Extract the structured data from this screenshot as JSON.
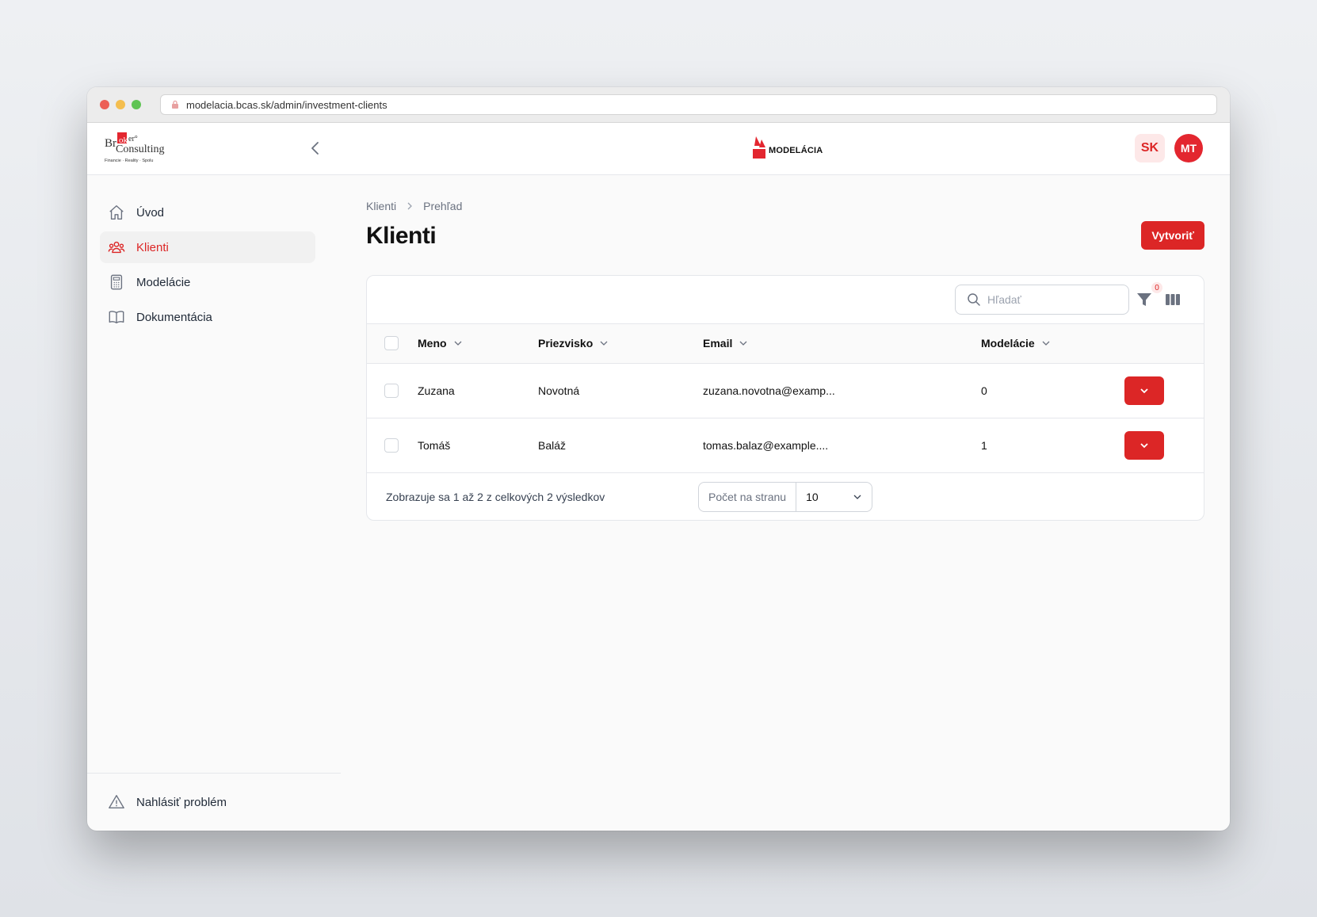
{
  "browser": {
    "url": "modelacia.bcas.sk/admin/investment-clients"
  },
  "topbar": {
    "brand_logo": "Broker Consulting",
    "brand_tagline": "Financie · Reality · Spolu",
    "app_logo_text": "MODELÁCIA",
    "language": "SK",
    "user_initials": "MT"
  },
  "sidebar": {
    "items": [
      {
        "label": "Úvod",
        "icon": "home-icon"
      },
      {
        "label": "Klienti",
        "icon": "users-icon",
        "active": true
      },
      {
        "label": "Modelácie",
        "icon": "calculator-icon"
      },
      {
        "label": "Dokumentácia",
        "icon": "book-icon"
      }
    ],
    "footer": {
      "label": "Nahlásiť problém",
      "icon": "warning-icon"
    }
  },
  "main": {
    "breadcrumb": [
      "Klienti",
      "Prehľad"
    ],
    "title": "Klienti",
    "create_label": "Vytvoriť",
    "search_placeholder": "Hľadať",
    "filter_count": "0",
    "table": {
      "columns": [
        "Meno",
        "Priezvisko",
        "Email",
        "Modelácie"
      ],
      "rows": [
        {
          "first": "Zuzana",
          "last": "Novotná",
          "email": "zuzana.novotna@examp...",
          "count": "0"
        },
        {
          "first": "Tomáš",
          "last": "Baláž",
          "email": "tomas.balaz@example....",
          "count": "1"
        }
      ]
    },
    "pagination": {
      "summary": "Zobrazuje sa 1 až 2 z celkových 2 výsledkov",
      "per_page_label": "Počet na stranu",
      "per_page_value": "10"
    }
  },
  "colors": {
    "accent": "#dc2626",
    "accent_light": "#fde8e8",
    "avatar": "#e3262f"
  }
}
